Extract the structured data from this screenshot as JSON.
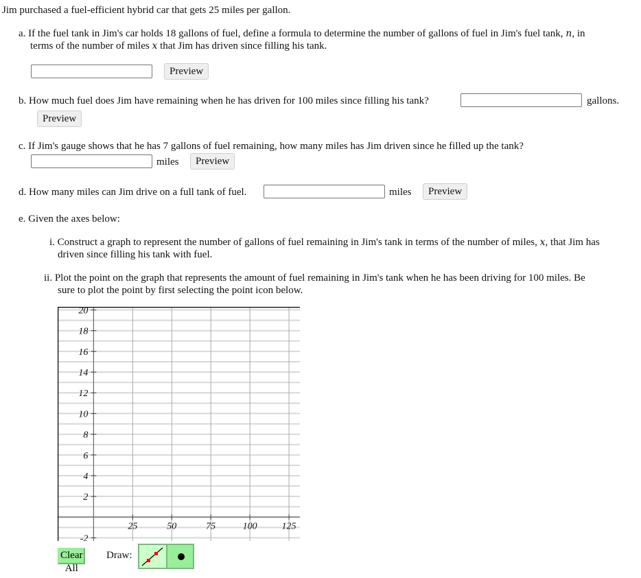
{
  "intro": "Jim purchased a fuel-efficient hybrid car that gets 25 miles per gallon.",
  "parts": {
    "a": {
      "marker": "a.",
      "line1_pre": "If the fuel tank in Jim's car holds 18 gallons of fuel, define a formula to determine the number of gallons of fuel in Jim's fuel tank, ",
      "var_n": "n",
      "line1_post": ", in",
      "line2_pre": "terms of the number of miles ",
      "var_x": "x",
      "line2_post": " that Jim has driven since filling his tank.",
      "input_value": "",
      "preview_label": "Preview"
    },
    "b": {
      "marker": "b.",
      "question": "How much fuel does Jim have remaining when he has driven for 100 miles since filling his tank?",
      "input_value": "",
      "unit": "gallons.",
      "preview_label": "Preview"
    },
    "c": {
      "marker": "c.",
      "question": "If Jim's gauge shows that he has 7 gallons of fuel remaining, how many miles has Jim driven since he filled up the tank?",
      "input_value": "",
      "unit": "miles",
      "preview_label": "Preview"
    },
    "d": {
      "marker": "d.",
      "question": "How many miles can Jim drive on a full tank of fuel.",
      "input_value": "",
      "unit": "miles",
      "preview_label": "Preview"
    },
    "e": {
      "marker": "e.",
      "intro": "Given the axes below:",
      "sub_i": {
        "marker": "i.",
        "line1_pre": "Construct a graph to represent the number of gallons of fuel remaining in Jim's tank in terms of the number of miles, ",
        "var_x": "x",
        "line1_post": ", that Jim has",
        "line2": "driven since filling his tank with fuel."
      },
      "sub_ii": {
        "marker": "ii.",
        "line1": "Plot the point on the graph that represents the amount of fuel remaining in Jim's tank when he has been driving for 100 miles. Be",
        "line2": "sure to plot the point by first selecting the point icon below."
      }
    }
  },
  "graph": {
    "x_range": [
      -23,
      132
    ],
    "y_range": [
      -2.3,
      20.3
    ],
    "x_ticks": [
      25,
      50,
      75,
      100,
      125
    ],
    "x_tick_labels": [
      "25",
      "50",
      "75",
      "100",
      "125"
    ],
    "y_ticks": [
      -2,
      2,
      4,
      6,
      8,
      10,
      12,
      14,
      16,
      18,
      20
    ],
    "y_tick_labels": [
      "-2",
      "2",
      "4",
      "6",
      "8",
      "10",
      "12",
      "14",
      "16",
      "18",
      "20"
    ],
    "x_grid_step": 25,
    "y_grid_step": 1
  },
  "toolbar": {
    "clear_label": "Clear All",
    "draw_label": "Draw:",
    "tools": [
      {
        "name": "line-tool",
        "icon": "line-segment-icon",
        "selected": true
      },
      {
        "name": "point-tool",
        "icon": "point-icon",
        "selected": false
      }
    ]
  },
  "colors": {
    "tool_green": "#99ee99",
    "tool_selected": "#ccffcc",
    "point_red": "#ff0000"
  }
}
